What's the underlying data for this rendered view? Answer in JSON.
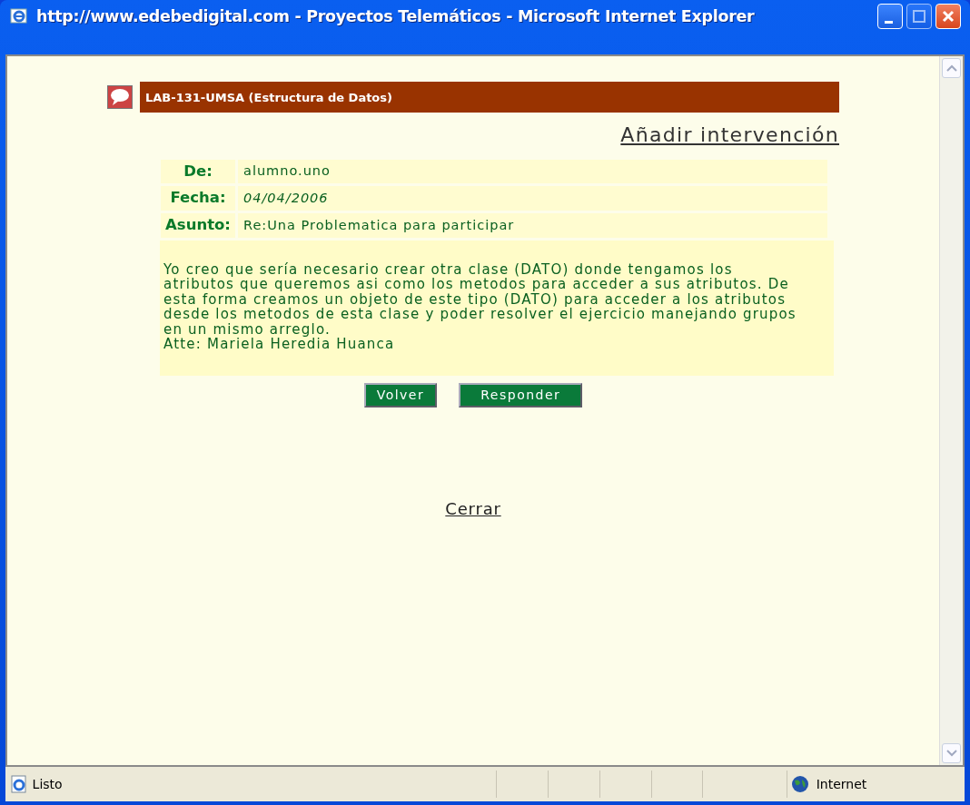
{
  "window": {
    "title": "http://www.edebedigital.com - Proyectos Telemáticos - Microsoft Internet Explorer"
  },
  "forum": {
    "title": "LAB-131-UMSA (Estructura de Datos)"
  },
  "add_link": "Añadir intervención",
  "fields": [
    {
      "label": "De:",
      "value": "alumno.uno",
      "italic": false
    },
    {
      "label": "Fecha:",
      "value": "04/04/2006",
      "italic": true
    },
    {
      "label": "Asunto:",
      "value": "Re:Una Problematica para participar",
      "italic": false
    }
  ],
  "message": [
    "Yo creo que sería necesario crear otra clase (DATO) donde tengamos los",
    "atributos que queremos asi como los metodos para acceder a sus atributos. De",
    "esta forma creamos un objeto de este tipo (DATO) para acceder a los atributos",
    "desde los metodos de esta clase y poder resolver el ejercicio manejando grupos",
    "en un mismo arreglo.",
    "Atte: Mariela Heredia Huanca"
  ],
  "buttons": [
    "Volver",
    "Responder"
  ],
  "close_link": "Cerrar",
  "status_bar": {
    "text": "Listo",
    "zone": "Internet"
  }
}
